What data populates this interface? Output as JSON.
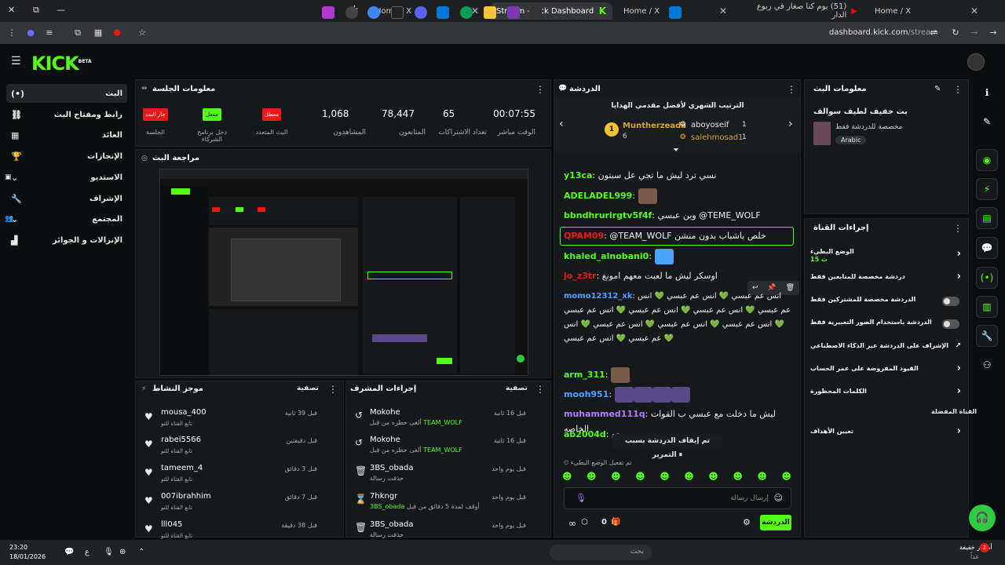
{
  "browser": {
    "tabs": [
      {
        "label": "Home / X"
      },
      {
        "label": "Stream - Kick Dashboard"
      },
      {
        "label": "Home / X"
      },
      {
        "label": "(51) يوم كنا صغار في ربوع الدار"
      },
      {
        "label": "Home / X"
      }
    ],
    "url_host": "dashboard.kick.com",
    "url_path": "/stream"
  },
  "brand": {
    "logo": "KICK",
    "logo_sup": "BETA",
    "accent": "#53fc18"
  },
  "nav": [
    {
      "label": "البث",
      "icon": "live-icon"
    },
    {
      "label": "رابط ومفتاح البث",
      "icon": "link-icon"
    },
    {
      "label": "العائد",
      "icon": "revenue-icon"
    },
    {
      "label": "الإنجازات",
      "icon": "trophy-icon"
    },
    {
      "label": "الاستديو",
      "icon": "studio-icon"
    },
    {
      "label": "الإشراف",
      "icon": "moderation-icon"
    },
    {
      "label": "المجتمع",
      "icon": "community-icon"
    },
    {
      "label": "الإنزالات و الجوائز",
      "icon": "drops-icon"
    }
  ],
  "session": {
    "title": "معلومات الجلسة",
    "stats": [
      {
        "value": "00:07:55",
        "label": "الوقت مباشر"
      },
      {
        "value": "65",
        "label": "تعداد الاشتراكات"
      },
      {
        "value": "78,447",
        "label": "المتابعون"
      },
      {
        "value": "1,068",
        "label": "المشاهدون"
      }
    ],
    "badges": [
      {
        "text": "معطل",
        "label": "البث المتعدد",
        "color": "#e91916"
      },
      {
        "text": "مفعل",
        "label": "دخل برنامج الشركاء",
        "color": "#53fc18"
      },
      {
        "text": "جار البث",
        "label": "الجلسة",
        "color": "#e91916"
      }
    ]
  },
  "preview": {
    "title": "مراجعة البث"
  },
  "activity": {
    "title": "موجز النشاط",
    "filter": "تصفية",
    "items": [
      {
        "name": "mousa_400",
        "sub": "تابع القناة للتو",
        "time": "قبل 39 ثانية"
      },
      {
        "name": "rabei5566",
        "sub": "تابع القناة للتو",
        "time": "قبل دقيقتين"
      },
      {
        "name": "tameem_4",
        "sub": "تابع القناة للتو",
        "time": "قبل 3 دقائق"
      },
      {
        "name": "007ibrahhim",
        "sub": "تابع القناة للتو",
        "time": "قبل 7 دقائق"
      },
      {
        "name": "lll045",
        "sub": "تابع القناة للتو",
        "time": "قبل 38 دقيقة"
      }
    ]
  },
  "modactions": {
    "title": "إجراءات المشرف",
    "filter": "تصفية",
    "items": [
      {
        "name": "Mokohe",
        "sub_pre": "ألغى حظره من قبل ",
        "sub_user": "TEAM_WOLF",
        "time": "قبل 16 ثانية",
        "icon": "undo-icon"
      },
      {
        "name": "Mokohe",
        "sub_pre": "ألغى حظره من قبل ",
        "sub_user": "TEAM_WOLF",
        "time": "قبل 16 ثانية",
        "icon": "undo-icon"
      },
      {
        "name": "3BS_obada",
        "sub_pre": "حذفت رسالة",
        "sub_user": "",
        "time": "قبل يوم واحد",
        "icon": "trash-icon"
      },
      {
        "name": "7hkngr",
        "sub_pre": "أوقف لمدة 5 دقائق من قبل ",
        "sub_user": "3BS_obada",
        "time": "قبل يوم واحد",
        "icon": "hourglass-icon"
      },
      {
        "name": "3BS_obada",
        "sub_pre": "حذفت رسالة",
        "sub_user": "",
        "time": "قبل يوم واحد",
        "icon": "trash-icon"
      }
    ]
  },
  "chat": {
    "title": "الدردشة",
    "leaderboard_title": "الترتيب الشهري لأفضل مقدمي الهدايا",
    "leaders": [
      {
        "rank": "1",
        "name": "Muntherzeada",
        "count": "6"
      },
      {
        "name": "aboyoseif",
        "count": "1"
      },
      {
        "name": "salehmosad1",
        "count": "1"
      }
    ],
    "messages": [
      {
        "user": "y13ca",
        "color": "#53fc18",
        "text": "نسي ترد ليش ما تجي عل سبتون"
      },
      {
        "user": "ADELADEL999",
        "color": "#53fc18",
        "text": ""
      },
      {
        "user": "bbndhrurirgtv5f4f",
        "color": "#53fc18",
        "text": "وين عبسي @TEME_WOLF"
      },
      {
        "user": "QPAM09",
        "color": "#e91916",
        "text": "@TEAM_WOLF خلص باشباب بدون منشن"
      },
      {
        "user": "khaled_alnobani0",
        "color": "#53fc18",
        "text": ""
      },
      {
        "user": "jo_z3tr",
        "color": "#e91916",
        "text": "اوسكر ليش ما لعبت معهم امونغ"
      },
      {
        "user": "momo12312_xk",
        "color": "#4aa3ff",
        "text": "انس عم عبسي 💚 انس عم عبسي 💚 انس عم عبسي 💚 انس عم عبسي 💚 انس عم عبسي 💚 انس عم عبسي 💚 انس عم عبسي 💚 انس عم عبسي 💚 انس عم عبسي 💚 انس عم عبسي 💚 انس عم عبسي 💚"
      },
      {
        "user": "arm_311",
        "color": "#53fc18",
        "text": ""
      },
      {
        "user": "mooh951",
        "color": "#4aa3ff",
        "text": ""
      },
      {
        "user": "muhammed111q",
        "color": "#b77cff",
        "text": "ليش ما دخلت مع عبسي ب القوات الخاصه"
      },
      {
        "user": "ab2004d",
        "color": "#53fc18",
        "text": "يرجع"
      }
    ],
    "paused": "تم إيقاف الدردشة بسبب التمرير",
    "slow_mode": "تم تفعيل الوضع البطيء",
    "input_placeholder": "إرسال رسالة",
    "points": "0",
    "send_label": "الدردشة"
  },
  "stream_info": {
    "title": "معلومات البث",
    "stream_title": "بث خفيف لطيف سوالف",
    "category": "مخصصة للدردشة فقط",
    "language": "Arabic"
  },
  "channel_actions": {
    "title": "إجراءات القناة",
    "rows": [
      {
        "label": "الوضع البطيء",
        "sub": "15 ث",
        "type": "chevron"
      },
      {
        "label": "دردشة مخصصة للمتابعين فقط",
        "type": "chevron"
      },
      {
        "label": "الدردشة مخصصة للمشتركين فقط",
        "type": "toggle"
      },
      {
        "label": "الدردشة باستخدام الصور التعبيرية فقط",
        "type": "toggle"
      },
      {
        "label": "الإشراف على الدردشة عبر الذكاء الاصطناعي",
        "type": "external"
      },
      {
        "label": "القيود المفروضة على عمر الحساب",
        "type": "chevron"
      },
      {
        "label": "الكلمات المحظورة",
        "type": "chevron"
      }
    ],
    "fav_label": "القناة المفضلة",
    "goals_label": "تعيين الأهداف"
  },
  "taskbar": {
    "time": "23:20",
    "date": "18/01/2026",
    "search": "بحث",
    "weather": "أمطار خفيفة",
    "weather_sub": "غداً",
    "notif": "2",
    "lang": "ع"
  }
}
